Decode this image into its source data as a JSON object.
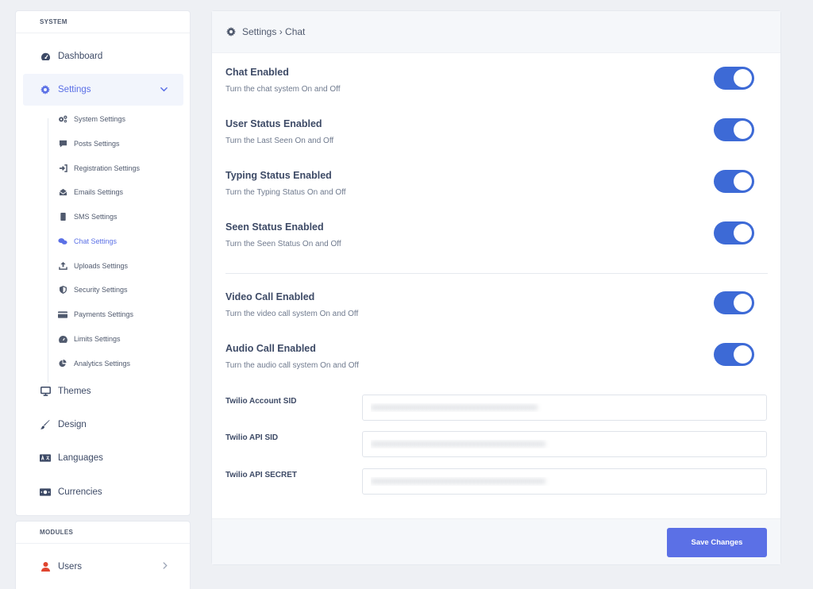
{
  "sidebar": {
    "system_header": "SYSTEM",
    "modules_header": "MODULES",
    "items": [
      {
        "label": "Dashboard",
        "icon": "dashboard-icon"
      },
      {
        "label": "Settings",
        "icon": "gear-icon",
        "active": true
      },
      {
        "label": "Themes",
        "icon": "monitor-icon"
      },
      {
        "label": "Design",
        "icon": "brush-icon"
      },
      {
        "label": "Languages",
        "icon": "language-icon"
      },
      {
        "label": "Currencies",
        "icon": "money-icon"
      }
    ],
    "sub_items": [
      {
        "label": "System Settings",
        "icon": "cogs-icon"
      },
      {
        "label": "Posts Settings",
        "icon": "comment-icon"
      },
      {
        "label": "Registration Settings",
        "icon": "sign-in-icon"
      },
      {
        "label": "Emails Settings",
        "icon": "envelope-open-icon"
      },
      {
        "label": "SMS Settings",
        "icon": "mobile-icon"
      },
      {
        "label": "Chat Settings",
        "icon": "comments-icon",
        "active": true
      },
      {
        "label": "Uploads Settings",
        "icon": "upload-icon"
      },
      {
        "label": "Security Settings",
        "icon": "shield-icon"
      },
      {
        "label": "Payments Settings",
        "icon": "credit-card-icon"
      },
      {
        "label": "Limits Settings",
        "icon": "gauge-icon"
      },
      {
        "label": "Analytics Settings",
        "icon": "pie-chart-icon"
      }
    ],
    "modules": [
      {
        "label": "Users",
        "icon": "user-icon"
      }
    ]
  },
  "main": {
    "breadcrumb": "Settings › Chat",
    "settings": [
      {
        "title": "Chat Enabled",
        "desc": "Turn the chat system On and Off",
        "enabled": true
      },
      {
        "title": "User Status Enabled",
        "desc": "Turn the Last Seen On and Off",
        "enabled": true
      },
      {
        "title": "Typing Status Enabled",
        "desc": "Turn the Typing Status On and Off",
        "enabled": true
      },
      {
        "title": "Seen Status Enabled",
        "desc": "Turn the Seen Status On and Off",
        "enabled": true
      },
      {
        "title": "Video Call Enabled",
        "desc": "Turn the video call system On and Off",
        "enabled": true
      },
      {
        "title": "Audio Call Enabled",
        "desc": "Turn the audio call system On and Off",
        "enabled": true
      }
    ],
    "fields": [
      {
        "label": "Twilio Account SID",
        "value": "xxxxxxxxxxxxxxxxxxxxxxxxxxxxxxxxxxxxxxxxxx"
      },
      {
        "label": "Twilio API SID",
        "value": "xxxxxxxxxxxxxxxxxxxxxxxxxxxxxxxxxxxxxxxxxxxx"
      },
      {
        "label": "Twilio API SECRET",
        "value": "xxxxxxxxxxxxxxxxxxxxxxxxxxxxxxxxxxxxxxxxxxxx"
      }
    ],
    "save_label": "Save Changes"
  },
  "colors": {
    "accent": "#5b70e6",
    "toggle_on": "#3d6ad6",
    "background": "#eef0f4"
  }
}
